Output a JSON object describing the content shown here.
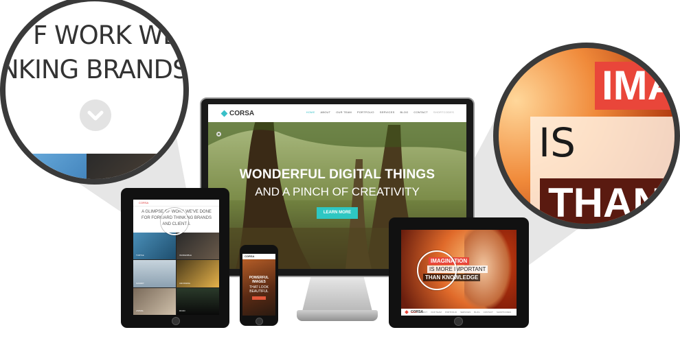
{
  "monitor": {
    "brand": "CORSA",
    "menu": [
      "HOME",
      "ABOUT",
      "OUR TEAM",
      "PORTFOLIO",
      "SERVICES",
      "BLOG",
      "CONTACT",
      "SHORTCODES"
    ],
    "hero_line1": "WONDERFUL DIGITAL THINGS",
    "hero_line2": "AND A PINCH OF CREATIVITY",
    "cta": "LEARN MORE"
  },
  "tablet_left": {
    "brand": "CORSA",
    "text": "A GLIMPSE OF WORK WE'VE DONE FOR FORWARD THINKING BRANDS AND CLIENTS.",
    "captions": [
      "TURTLE",
      "INCREDIBLE",
      "SUMMIT",
      "CROSSING",
      "ANIMAL",
      "ROAD"
    ]
  },
  "phone": {
    "brand": "CORSA",
    "line1": "POWERFUL",
    "line2": "IMAGES",
    "line3": "THAT LOOK",
    "line4": "BEAUTIFUL"
  },
  "tablet_right": {
    "brand": "CORSA",
    "line1": "IMAGINATION",
    "line2": "IS MORE IMPORTANT",
    "line3": "THAN KNOWLEDGE",
    "menu": [
      "HOME",
      "ABOUT",
      "OUR TEAM",
      "PORTFOLIO",
      "SERVICES",
      "BLOG",
      "CONTACT",
      "SHORTCODES"
    ]
  },
  "magnifier_left": {
    "line1": "F WORK WE'V",
    "line2": "NKING BRANDS"
  },
  "magnifier_right": {
    "line1": "IMA",
    "line2": "IS MOR",
    "line3": "THAN"
  },
  "colors": {
    "accent": "#39c0c8",
    "button": "#2ec7c2",
    "red": "#e9463a"
  }
}
